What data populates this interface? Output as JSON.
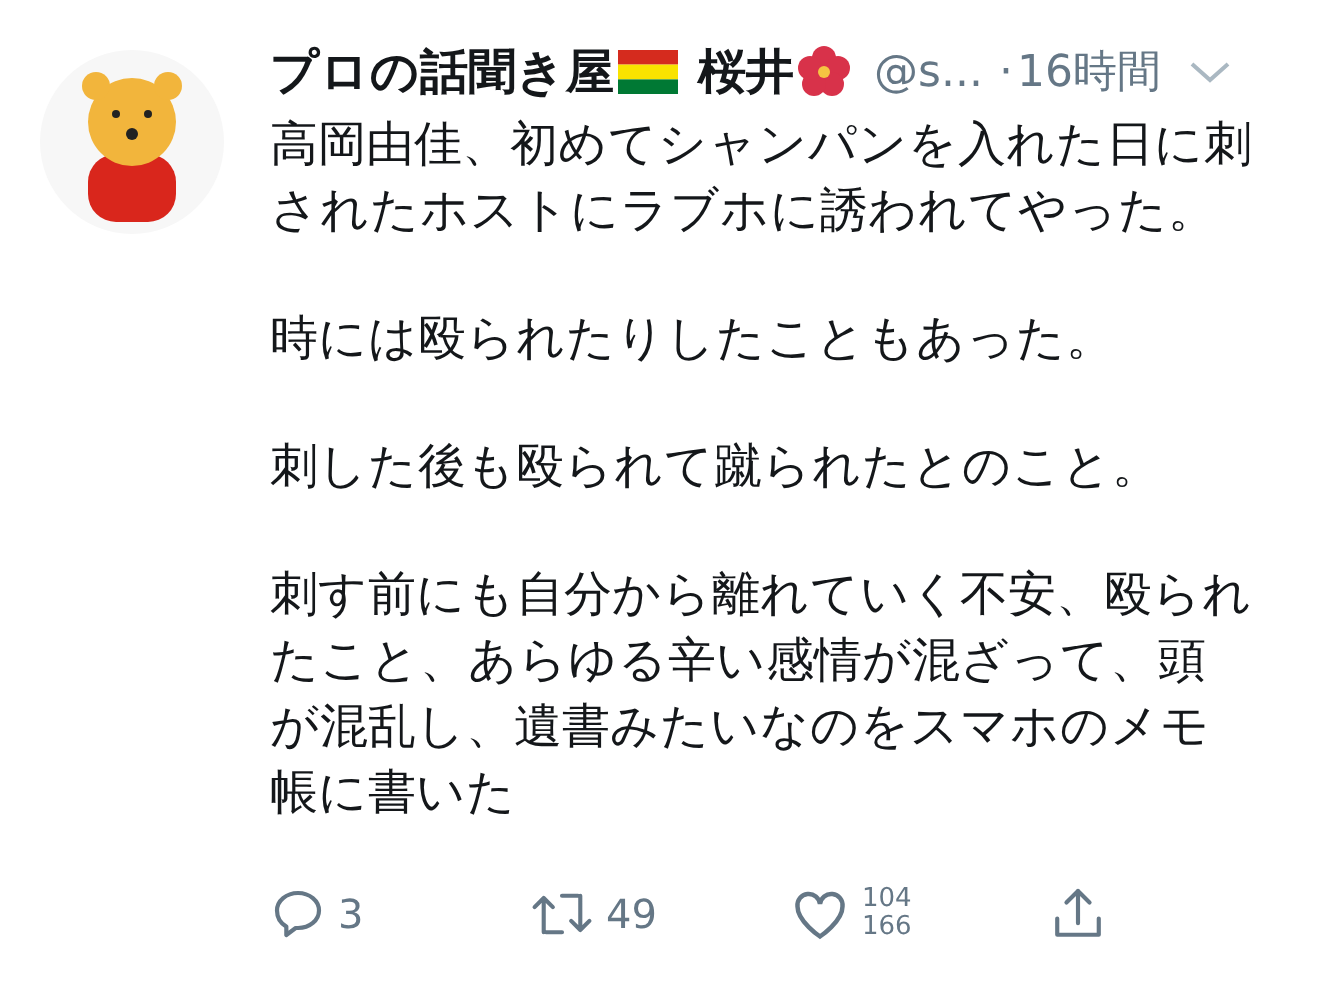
{
  "tweet": {
    "display_name": "プロの話聞き屋",
    "display_name_2": "桜井",
    "handle": "@s...",
    "separator": "·",
    "time": "16時間",
    "paragraphs": [
      "高岡由佳、初めてシャンパンを入れた日に刺されたホストにラブホに誘われてやった。",
      "時には殴られたりしたこともあった。",
      "刺した後も殴られて蹴られたとのこと。",
      "刺す前にも自分から離れていく不安、殴られたこと、あらゆる辛い感情が混ざって、頭が混乱し、遺書みたいなのをスマホのメモ帳に書いた"
    ],
    "actions": [
      {
        "kind": "reply",
        "count": "3"
      },
      {
        "kind": "retweet",
        "count": "49"
      },
      {
        "kind": "like",
        "count": "104",
        "count_2": "166"
      },
      {
        "kind": "share"
      }
    ]
  }
}
